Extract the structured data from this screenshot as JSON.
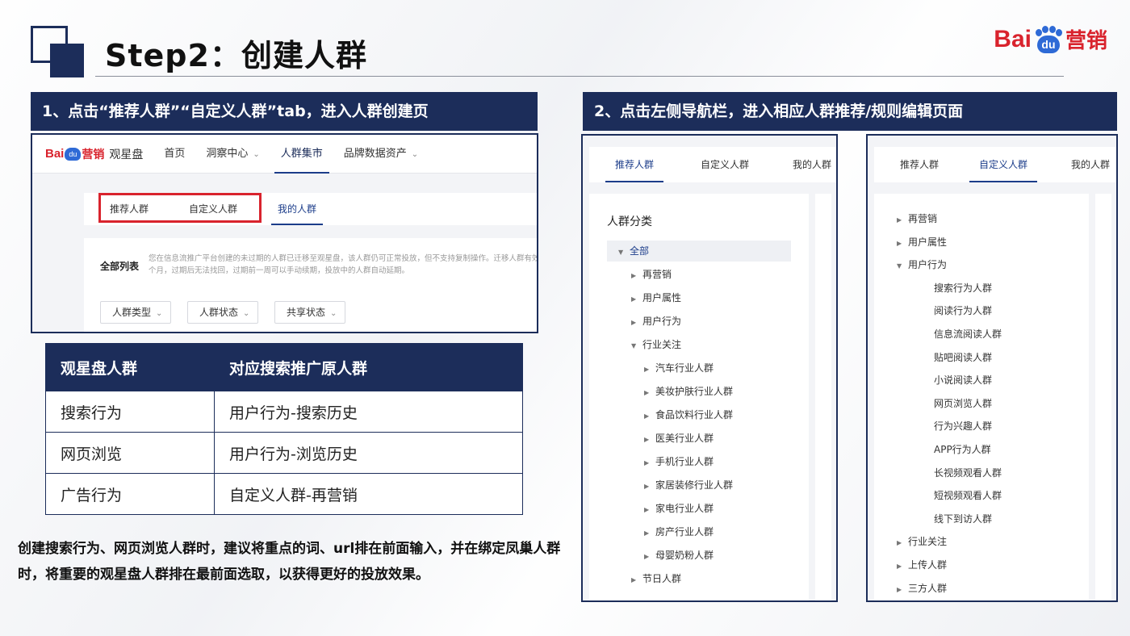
{
  "slide": {
    "title": "Step2：创建人群",
    "brand": {
      "bai": "Bai",
      "du": "du",
      "ying": "营销"
    }
  },
  "step1": {
    "banner": "1、点击“推荐人群”“自定义人群”tab，进入人群创建页",
    "logo": {
      "bai": "Bai",
      "du": "du",
      "ying": "营销",
      "app": "观星盘"
    },
    "nav": [
      "首页",
      "洞察中心",
      "人群集市",
      "品牌数据资产"
    ],
    "tabs": [
      "推荐人群",
      "自定义人群",
      "我的人群"
    ],
    "all_list": "全部列表",
    "notice": "您在信息流推广平台创建的未过期的人群已迁移至观星盘，该人群仍可正常投放，但不支持复制操作。迁移人群有效期三个月，过期后无法找回，过期前一周可以手动续期，投放中的人群自动延期。",
    "filters": [
      "人群类型",
      "人群状态",
      "共享状态"
    ]
  },
  "mapping_table": {
    "headers": [
      "观星盘人群",
      "对应搜索推广原人群"
    ],
    "rows": [
      [
        "搜索行为",
        "用户行为-搜索历史"
      ],
      [
        "网页浏览",
        "用户行为-浏览历史"
      ],
      [
        "广告行为",
        "自定义人群-再营销"
      ]
    ]
  },
  "note": "创建搜索行为、网页浏览人群时，建议将重点的词、url排在前面输入，并在绑定凤巢人群时，将重要的观星盘人群排在最前面选取，以获得更好的投放效果。",
  "step2": {
    "banner": "2、点击左侧导航栏，进入相应人群推荐/规则编辑页面",
    "left_panel": {
      "tabs": [
        "推荐人群",
        "自定义人群",
        "我的人群"
      ],
      "section_title": "人群分类",
      "tree": [
        {
          "label": "全部",
          "level": 0,
          "expanded": true,
          "selected": true
        },
        {
          "label": "再营销",
          "level": 1,
          "expanded": false
        },
        {
          "label": "用户属性",
          "level": 1,
          "expanded": false
        },
        {
          "label": "用户行为",
          "level": 1,
          "expanded": false
        },
        {
          "label": "行业关注",
          "level": 1,
          "expanded": true
        },
        {
          "label": "汽车行业人群",
          "level": 2,
          "expanded": false
        },
        {
          "label": "美妆护肤行业人群",
          "level": 2,
          "expanded": false
        },
        {
          "label": "食品饮料行业人群",
          "level": 2,
          "expanded": false
        },
        {
          "label": "医美行业人群",
          "level": 2,
          "expanded": false
        },
        {
          "label": "手机行业人群",
          "level": 2,
          "expanded": false
        },
        {
          "label": "家居装修行业人群",
          "level": 2,
          "expanded": false
        },
        {
          "label": "家电行业人群",
          "level": 2,
          "expanded": false
        },
        {
          "label": "房产行业人群",
          "level": 2,
          "expanded": false
        },
        {
          "label": "母婴奶粉人群",
          "level": 2,
          "expanded": false
        },
        {
          "label": "节日人群",
          "level": 1,
          "expanded": false
        }
      ]
    },
    "right_panel": {
      "tabs": [
        "推荐人群",
        "自定义人群",
        "我的人群"
      ],
      "tree": [
        {
          "label": "再营销",
          "level": 0,
          "expanded": false
        },
        {
          "label": "用户属性",
          "level": 0,
          "expanded": false
        },
        {
          "label": "用户行为",
          "level": 0,
          "expanded": true
        },
        {
          "label": "搜索行为人群",
          "level": 1,
          "leaf": true
        },
        {
          "label": "阅读行为人群",
          "level": 1,
          "leaf": true
        },
        {
          "label": "信息流阅读人群",
          "level": 1,
          "leaf": true
        },
        {
          "label": "贴吧阅读人群",
          "level": 1,
          "leaf": true
        },
        {
          "label": "小说阅读人群",
          "level": 1,
          "leaf": true
        },
        {
          "label": "网页浏览人群",
          "level": 1,
          "leaf": true
        },
        {
          "label": "行为兴趣人群",
          "level": 1,
          "leaf": true
        },
        {
          "label": "APP行为人群",
          "level": 1,
          "leaf": true
        },
        {
          "label": "长视频观看人群",
          "level": 1,
          "leaf": true
        },
        {
          "label": "短视频观看人群",
          "level": 1,
          "leaf": true
        },
        {
          "label": "线下到访人群",
          "level": 1,
          "leaf": true
        },
        {
          "label": "行业关注",
          "level": 0,
          "expanded": false
        },
        {
          "label": "上传人群",
          "level": 0,
          "expanded": false
        },
        {
          "label": "三方人群",
          "level": 0,
          "expanded": false
        }
      ]
    }
  }
}
